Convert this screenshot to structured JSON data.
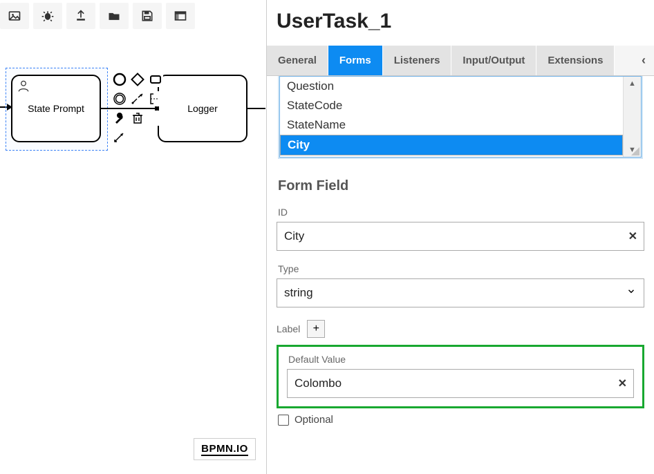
{
  "canvas": {
    "user_task_label": "State Prompt",
    "logger_label": "Logger",
    "logo": "BPMN.IO"
  },
  "panel": {
    "title": "UserTask_1",
    "tabs": {
      "general": "General",
      "forms": "Forms",
      "listeners": "Listeners",
      "io": "Input/Output",
      "extensions": "Extensions"
    },
    "form_fields": {
      "items": [
        "Question",
        "StateCode",
        "StateName",
        "City"
      ],
      "selected": "City"
    },
    "section_header": "Form Field",
    "id": {
      "label": "ID",
      "value": "City"
    },
    "type": {
      "label": "Type",
      "value": "string"
    },
    "label": {
      "label": "Label"
    },
    "default_value": {
      "label": "Default Value",
      "value": "Colombo"
    },
    "optional_label": "Optional"
  }
}
